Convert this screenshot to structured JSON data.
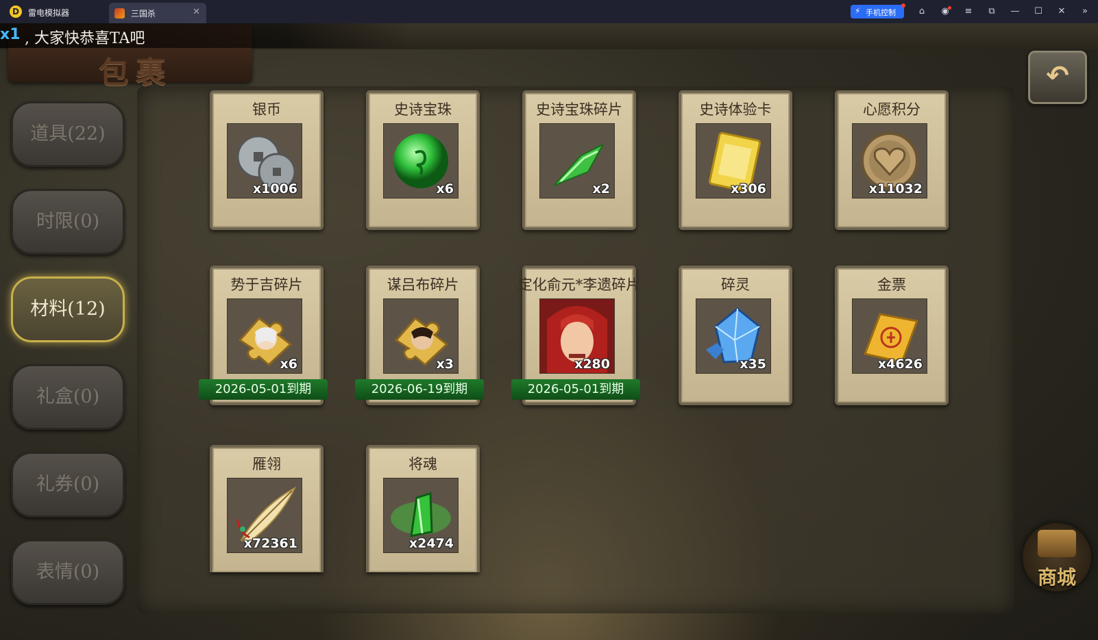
{
  "emulator": {
    "app_name": "雷电模拟器",
    "tab_label": "三国杀",
    "phone_control_label": "手机控制"
  },
  "game": {
    "page_title": "包裹",
    "marquee": {
      "count": "x1",
      "text": ", 大家快恭喜TA吧"
    },
    "side_tabs": [
      {
        "label": "道具(22)",
        "active": false
      },
      {
        "label": "时限(0)",
        "active": false
      },
      {
        "label": "材料(12)",
        "active": true
      },
      {
        "label": "礼盒(0)",
        "active": false
      },
      {
        "label": "礼券(0)",
        "active": false
      },
      {
        "label": "表情(0)",
        "active": false
      }
    ],
    "items": [
      {
        "name": "银币",
        "qty": "x1006",
        "icon": "silver-coins-icon"
      },
      {
        "name": "史诗宝珠",
        "qty": "x6",
        "icon": "green-orb-icon"
      },
      {
        "name": "史诗宝珠碎片",
        "qty": "x2",
        "icon": "green-shard-icon"
      },
      {
        "name": "史诗体验卡",
        "qty": "x306",
        "icon": "gold-card-icon"
      },
      {
        "name": "心愿积分",
        "qty": "x11032",
        "icon": "heart-coin-icon"
      },
      {
        "name": "势于吉碎片",
        "qty": "x6",
        "icon": "puzzle-hero-icon",
        "expiry": "2026-05-01到期"
      },
      {
        "name": "谋吕布碎片",
        "qty": "x3",
        "icon": "puzzle-hero-icon",
        "expiry": "2026-06-19到期"
      },
      {
        "name": "定化俞元*李遗碎片",
        "qty": "x280",
        "icon": "hero-portrait-icon",
        "expiry": "2026-05-01到期"
      },
      {
        "name": "碎灵",
        "qty": "x35",
        "icon": "blue-crystal-icon"
      },
      {
        "name": "金票",
        "qty": "x4626",
        "icon": "gold-scroll-icon"
      },
      {
        "name": "雁翎",
        "qty": "x72361",
        "icon": "feather-icon"
      },
      {
        "name": "将魂",
        "qty": "x2474",
        "icon": "green-soul-icon"
      }
    ],
    "shop_label": "商城"
  }
}
